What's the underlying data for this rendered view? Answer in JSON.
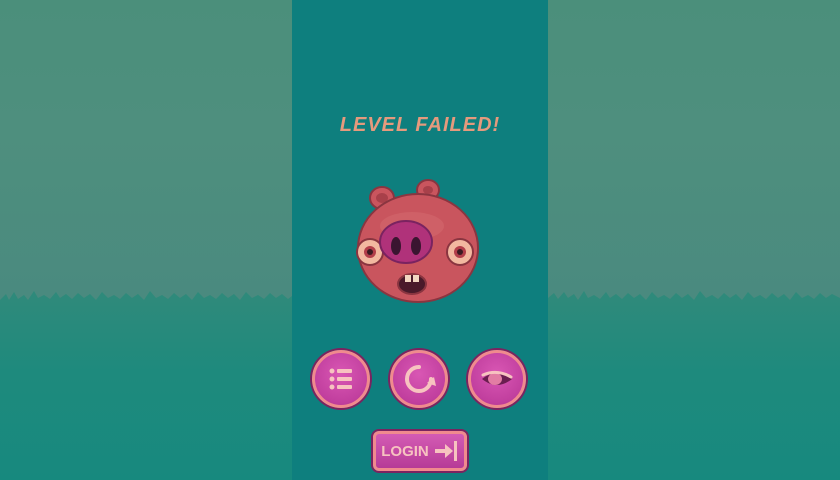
{
  "screen": {
    "title": "LEVEL FAILED!",
    "character_icon": "sad-pig-icon"
  },
  "buttons": {
    "menu_icon": "level-list-icon",
    "restart_icon": "restart-icon",
    "skip_icon": "eye-slash-icon",
    "login_label": "LOGIN",
    "login_icon": "login-arrow-icon"
  },
  "colors": {
    "panel": "#0e7f7e",
    "title": "#e59a7d",
    "button": "#c13f9e",
    "button_border": "#f08a8e",
    "pig": "#c9555e"
  }
}
